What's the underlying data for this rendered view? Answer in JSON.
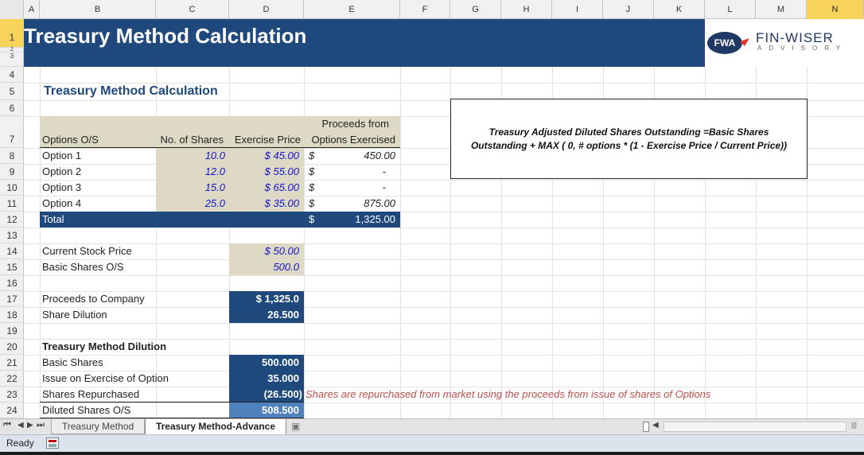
{
  "columns": [
    "A",
    "B",
    "C",
    "D",
    "E",
    "F",
    "G",
    "H",
    "I",
    "J",
    "K",
    "L",
    "M",
    "N"
  ],
  "rows": [
    "1",
    "2",
    "3",
    "4",
    "5",
    "6",
    "7",
    "8",
    "9",
    "10",
    "11",
    "12",
    "13",
    "14",
    "15",
    "16",
    "17",
    "18",
    "19",
    "20",
    "21",
    "22",
    "23",
    "24"
  ],
  "banner": {
    "title": "Treasury Method Calculation"
  },
  "logo": {
    "brand": "FIN-WISER",
    "sub": "ADVISORY",
    "badge": "FWA"
  },
  "section_title": "Treasury Method Calculation",
  "options_table": {
    "headers": {
      "col_b": "Options O/S",
      "col_c": "No. of Shares",
      "col_d": "Exercise Price",
      "col_e_top": "Proceeds from",
      "col_e": "Options Exercised"
    },
    "rows": [
      {
        "name": "Option 1",
        "shares": "10.0",
        "price": "$ 45.00",
        "cur": "$",
        "proceeds": "450.00"
      },
      {
        "name": "Option 2",
        "shares": "12.0",
        "price": "$ 55.00",
        "cur": "$",
        "proceeds": "-"
      },
      {
        "name": "Option 3",
        "shares": "15.0",
        "price": "$ 65.00",
        "cur": "$",
        "proceeds": "-"
      },
      {
        "name": "Option 4",
        "shares": "25.0",
        "price": "$ 35.00",
        "cur": "$",
        "proceeds": "875.00"
      }
    ],
    "total": {
      "label": "Total",
      "cur": "$",
      "value": "1,325.00"
    }
  },
  "inputs": {
    "stock_price_label": "Current Stock Price",
    "stock_price": "$ 50.00",
    "basic_shares_label": "Basic Shares O/S",
    "basic_shares": "500.0"
  },
  "results": {
    "proceeds_label": "Proceeds to Company",
    "proceeds": "$ 1,325.0",
    "dilution_label": "Share Dilution",
    "dilution": "26.500"
  },
  "dilution": {
    "heading": "Treasury Method Dilution",
    "basic_label": "Basic Shares",
    "basic": "500.000",
    "issue_label": "Issue on Exercise of Option",
    "issue": "35.000",
    "repurchased_label": "Shares Repurchased",
    "repurchased": "(26.500)",
    "repurchased_note": "Shares are repurchased from market using the proceeds from issue of shares of Options",
    "diluted_label": "Diluted Shares O/S",
    "diluted": "508.500"
  },
  "formula_box": {
    "line1": "Treasury Adjusted Diluted Shares Outstanding =Basic Shares",
    "line2": "Outstanding + MAX ( 0, # options * (1 - Exercise Price / Current Price))"
  },
  "sheet_tabs": [
    {
      "label": "Treasury Method",
      "active": false
    },
    {
      "label": "Treasury Method-Advance",
      "active": true
    }
  ],
  "status": {
    "text": "Ready"
  },
  "colors": {
    "navy": "#1f497d",
    "tan": "#ddd9c4",
    "input_blue": "#1414c8",
    "note_red": "#c0504d"
  }
}
